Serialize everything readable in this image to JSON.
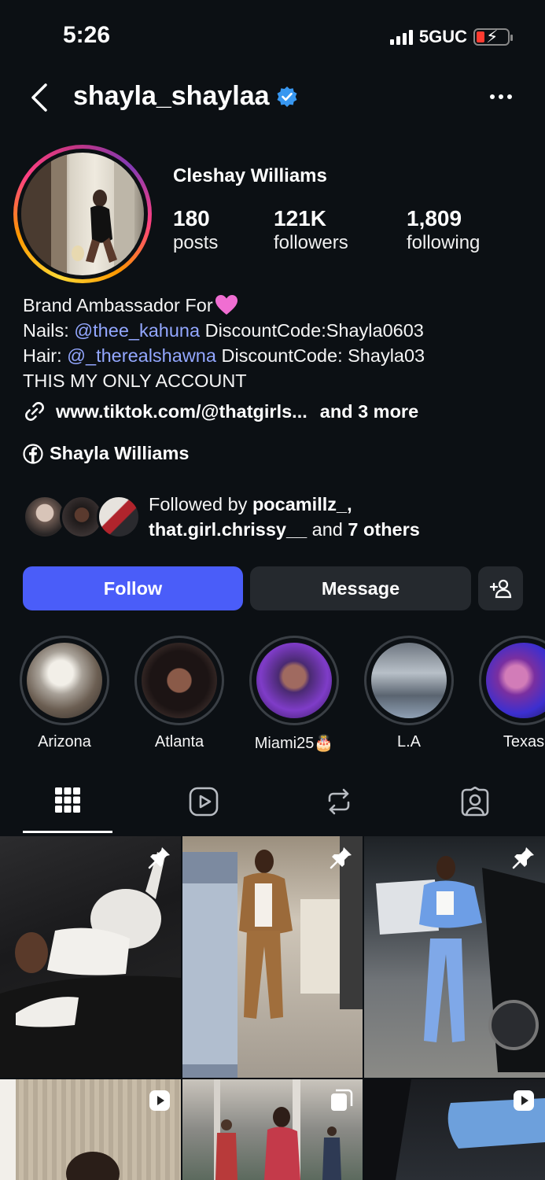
{
  "status": {
    "time": "5:26",
    "network": "5GUC"
  },
  "header": {
    "username": "shayla_shaylaa"
  },
  "profile": {
    "display_name": "Cleshay Williams",
    "stats": [
      {
        "value": "180",
        "label": "posts"
      },
      {
        "value": "121K",
        "label": "followers"
      },
      {
        "value": "1,809",
        "label": "following"
      }
    ],
    "bio": {
      "line1": "Brand Ambassador For",
      "line2_prefix": "Nails: ",
      "line2_mention": "@thee_kahuna",
      "line2_suffix": " DiscountCode:Shayla0603",
      "line3_prefix": "Hair: ",
      "line3_mention": "@_therealshawna",
      "line3_suffix": " DiscountCode: Shayla03",
      "line4": "THIS MY ONLY ACCOUNT"
    },
    "link": {
      "url": "www.tiktok.com/@thatgirls...",
      "more": "and 3 more"
    },
    "facebook": "Shayla Williams",
    "followed_by": {
      "prefix": "Followed by ",
      "user1": "pocamillz_,",
      "user2": "that.girl.chrissy__",
      "middle": " and ",
      "others": "7 others"
    }
  },
  "actions": {
    "follow": "Follow",
    "message": "Message"
  },
  "highlights": [
    {
      "label": "Arizona"
    },
    {
      "label": "Atlanta"
    },
    {
      "label": "Miami25🎂"
    },
    {
      "label": "L.A"
    },
    {
      "label": "Texas"
    }
  ],
  "tabs": [
    "grid-icon",
    "reels-icon",
    "reposts-icon",
    "tagged-icon"
  ],
  "colors": {
    "accent": "#4a5df9",
    "background": "#0c1014",
    "mention": "#93a7ff",
    "verified": "#3897f0"
  }
}
